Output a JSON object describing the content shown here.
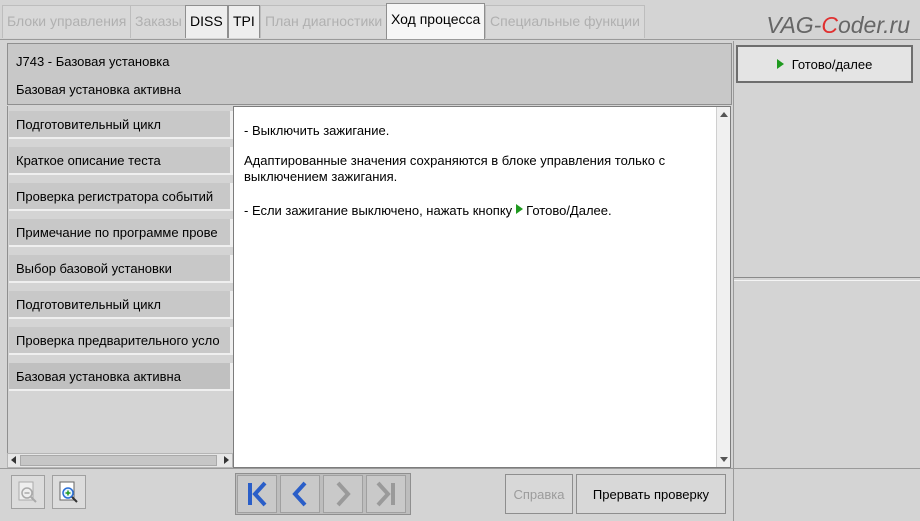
{
  "tabs": [
    {
      "label": "Блоки управления",
      "state": "disabled"
    },
    {
      "label": "Заказы",
      "state": "disabled"
    },
    {
      "label": "DISS",
      "state": "enabled"
    },
    {
      "label": "TPI",
      "state": "enabled"
    },
    {
      "label": "План диагностики",
      "state": "disabled"
    },
    {
      "label": "Ход процесса",
      "state": "active"
    },
    {
      "label": "Специальные функции",
      "state": "disabled"
    }
  ],
  "watermark": {
    "pre": "VAG-",
    "accent": "C",
    "post": "oder.ru"
  },
  "header": {
    "title": "J743 - Базовая установка",
    "status": "Базовая установка активна"
  },
  "steps": [
    "Подготовительный цикл",
    "Краткое описание теста",
    "Проверка регистратора событий",
    "Примечание по программе прове",
    "Выбор базовой установки",
    "Подготовительный цикл",
    "Проверка предварительного усло",
    "Базовая установка активна"
  ],
  "content": {
    "line1": "- Выключить зажигание.",
    "line2": "Адаптированные значения сохраняются в блоке управления только с выключением зажигания.",
    "line3_prefix": "- Если зажигание выключено, нажать кнопку",
    "line3_suffix": "Готово/Далее."
  },
  "buttons": {
    "ready": "Готово/далее",
    "help": "Справка",
    "abort": "Прервать проверку"
  },
  "icons": {
    "zoom_out": "zoom-out-icon",
    "zoom_in": "zoom-in-icon",
    "first": "first-page-icon",
    "prev": "prev-page-icon",
    "next": "next-page-icon",
    "last": "last-page-icon",
    "play": "play-icon"
  },
  "colors": {
    "accent_green": "#1f9a1f",
    "nav_blue": "#2a5ec8",
    "nav_disabled": "#9a9a9a"
  }
}
